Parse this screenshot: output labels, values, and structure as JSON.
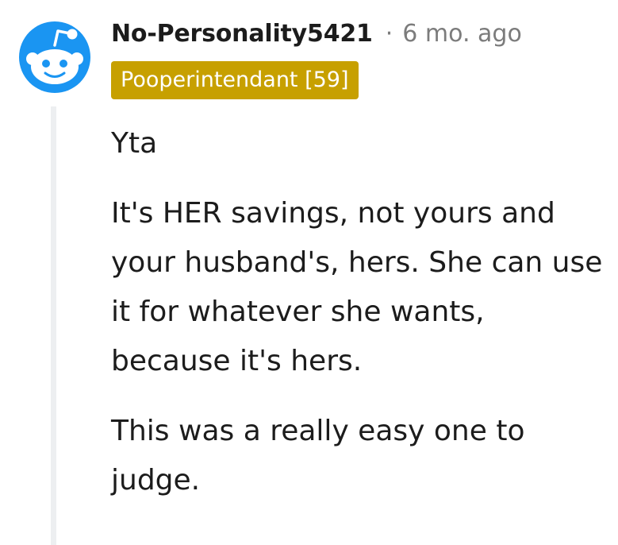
{
  "comment": {
    "author": "No-Personality5421",
    "separator": "·",
    "timestamp": "6 mo. ago",
    "flair": "Pooperintendant [59]",
    "paragraphs": [
      "Yta",
      "It's HER savings, not yours and your husband's, hers. She can use it for whatever she wants, because it's hers.",
      "This was a really easy one to judge."
    ]
  },
  "icons": {
    "avatar": "snoo-avatar-icon"
  },
  "colors": {
    "avatar_bg": "#1a95f2",
    "flair_bg": "#c7a000",
    "flair_text": "#ffffff",
    "meta_text": "#7c7c7c",
    "thread_line": "#edeff1"
  }
}
